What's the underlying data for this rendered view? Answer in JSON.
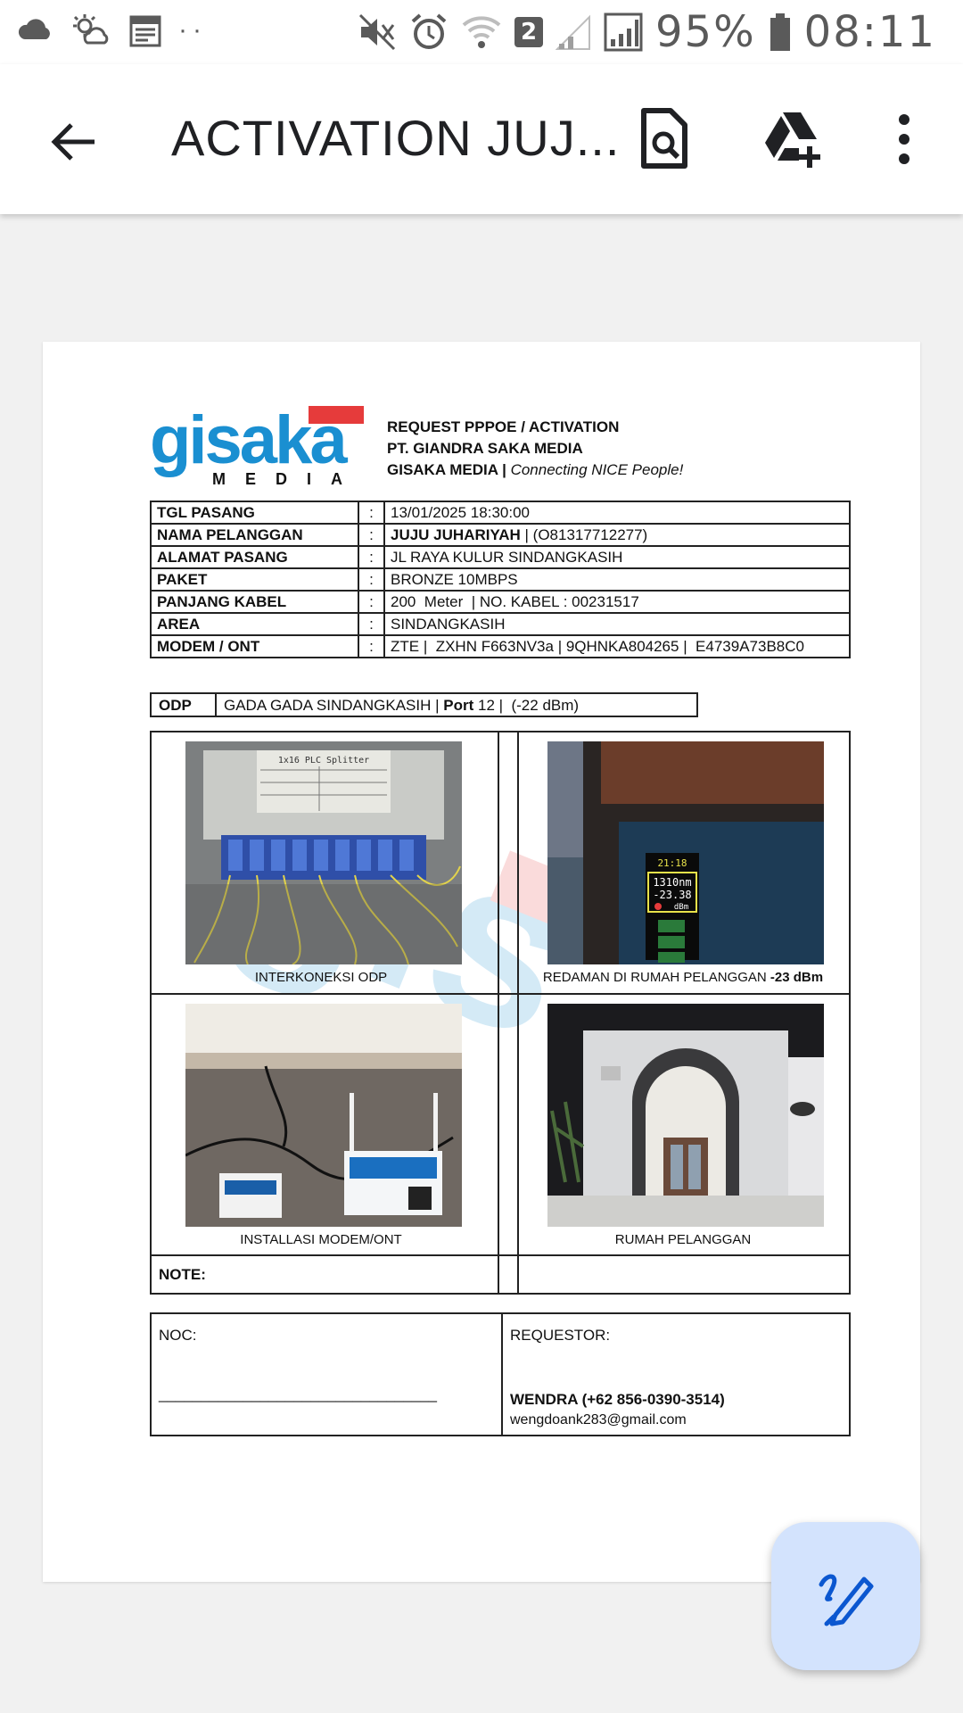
{
  "status_bar": {
    "battery": "95%",
    "time": "08:11",
    "sim_badge": "2",
    "dots": "··"
  },
  "app_bar": {
    "title": "ACTIVATION JUJ..."
  },
  "document": {
    "logo_text": "gisaka",
    "logo_sub": "M E D I A",
    "header_line1": "REQUEST PPPOE / ACTIVATION",
    "header_line2": "PT. GIANDRA SAKA MEDIA",
    "header_line3_bold": "GISAKA MEDIA |",
    "header_line3_tag": "Connecting NICE People!",
    "info_rows": [
      {
        "key": "TGL PASANG",
        "sep": ":",
        "value": "13/01/2025 18:30:00"
      },
      {
        "key": "NAMA PELANGGAN",
        "sep": ":",
        "value_bold": "JUJU JUHARIYAH",
        "value": " | (O81317712277)"
      },
      {
        "key": "ALAMAT PASANG",
        "sep": ":",
        "value": "JL RAYA KULUR SINDANGKASIH"
      },
      {
        "key": "PAKET",
        "sep": ":",
        "value": "BRONZE 10MBPS"
      },
      {
        "key": "PANJANG KABEL",
        "sep": ":",
        "value": "200  Meter  | NO. KABEL : 00231517"
      },
      {
        "key": "AREA",
        "sep": ":",
        "value": "SINDANGKASIH"
      },
      {
        "key": "MODEM / ONT",
        "sep": ":",
        "value": "ZTE |  ZXHN F663NV3a | 9QHNKA804265 |  E4739A73B8C0"
      }
    ],
    "odp_label": "ODP",
    "odp_value_pre": "GADA GADA SINDANGKASIH | ",
    "odp_port_label": "Port",
    "odp_value_post": " 12 |  (-22 dBm)",
    "photos": {
      "p1_caption": "INTERKONEKSI ODP",
      "p2_caption_pre": "REDAMAN DI RUMAH PELANGGAN ",
      "p2_caption_bold": "-23 dBm",
      "p3_caption": "INSTALLASI MODEM/ONT",
      "p4_caption": "RUMAH PELANGGAN",
      "p1_label_top": "1x16 PLC Splitter",
      "p2_meter_time": "21:18",
      "p2_meter_nm": "1310nm",
      "p2_meter_val": "-23.38",
      "p2_meter_unit": "dBm"
    },
    "note_label": "NOTE:",
    "noc_label": "NOC:",
    "noc_line": "_________________________________",
    "requestor_label": "REQUESTOR:",
    "requestor_name": "WENDRA (+62 856-0390-3514)",
    "requestor_email": "wengdoank283@gmail.com"
  },
  "colors": {
    "brand_blue": "#1a8fd1",
    "brand_red": "#e63b3b",
    "fab_bg": "#d3e3fd",
    "fab_icon": "#0b57d0"
  },
  "icons": [
    "cloud-icon",
    "weather-icon",
    "calendar-icon",
    "mute-icon",
    "alarm-icon",
    "wifi-icon",
    "signal-icon",
    "battery-icon",
    "back-arrow-icon",
    "doc-search-icon",
    "drive-add-icon",
    "more-vert-icon",
    "edit-pen-icon"
  ]
}
